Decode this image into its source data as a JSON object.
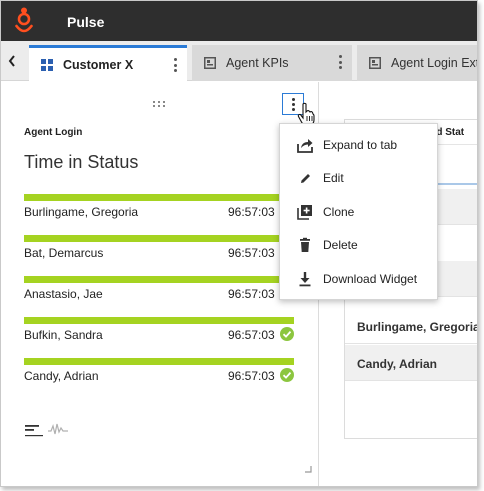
{
  "app": {
    "title": "Pulse",
    "logo": "genesys-logo"
  },
  "tabs": [
    {
      "label": "Customer X",
      "icon": "dashboard-grid-icon",
      "active": true
    },
    {
      "label": "Agent KPIs",
      "icon": "widget-icon",
      "active": false
    },
    {
      "label": "Agent Login Ext",
      "icon": "widget-icon",
      "active": false
    }
  ],
  "widget": {
    "subtitle": "Agent Login",
    "title": "Time in Status",
    "rows": [
      {
        "name": "Burlingame, Gregoria",
        "value": "96:57:03",
        "check": false
      },
      {
        "name": "Bat, Demarcus",
        "value": "96:57:03",
        "check": false
      },
      {
        "name": "Anastasio, Jae",
        "value": "96:57:03",
        "check": false
      },
      {
        "name": "Bufkin, Sandra",
        "value": "96:57:03",
        "check": true
      },
      {
        "name": "Candy, Adrian",
        "value": "96:57:03",
        "check": true
      }
    ]
  },
  "right_widget": {
    "header": "led Stat",
    "rows": [
      "Burlingame, Gregoria",
      "Candy, Adrian"
    ]
  },
  "menu": {
    "items": [
      {
        "label": "Expand to tab",
        "icon": "expand-to-tab-icon"
      },
      {
        "label": "Edit",
        "icon": "pencil-icon"
      },
      {
        "label": "Clone",
        "icon": "clone-icon"
      },
      {
        "label": "Delete",
        "icon": "trash-icon"
      },
      {
        "label": "Download Widget",
        "icon": "download-icon"
      }
    ]
  },
  "colors": {
    "accent": "#2b7bd6",
    "bar": "#a5d321",
    "check": "#8cc63f",
    "topbar": "#2e2e2e",
    "logo": "#ff4f1f"
  }
}
